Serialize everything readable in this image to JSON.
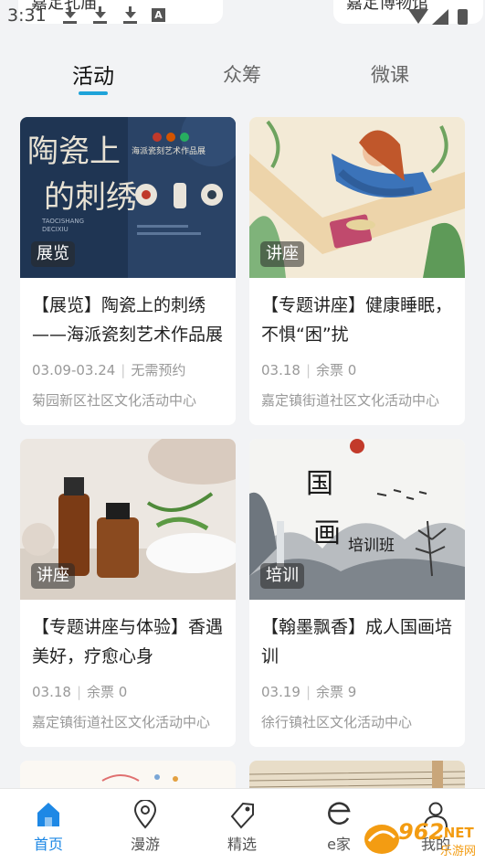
{
  "status_bar": {
    "time": "3:31",
    "chip_left": "嘉定孔庙",
    "chip_right": "嘉定博物馆"
  },
  "tabs": [
    {
      "label": "活动",
      "active": true
    },
    {
      "label": "众筹",
      "active": false
    },
    {
      "label": "微课",
      "active": false
    }
  ],
  "cards": [
    {
      "badge": "展览",
      "title": "【展览】陶瓷上的刺绣——海派瓷刻艺术作品展",
      "date": "03.09-03.24",
      "info": "无需预约",
      "venue": "菊园新区社区文化活动中心",
      "poster_text": {
        "title1": "陶瓷上",
        "title2": "的刺绣",
        "subtitle": "海派瓷刻艺术作品展",
        "pinyin": "TAOCISHANG DECIXIU"
      }
    },
    {
      "badge": "讲座",
      "title": "【专题讲座】健康睡眠，不惧“困”扰",
      "date": "03.18",
      "info": "余票 0",
      "venue": "嘉定镇街道社区文化活动中心"
    },
    {
      "badge": "讲座",
      "title": "【专题讲座与体验】香遇美好，疗愈心身",
      "date": "03.18",
      "info": "余票 0",
      "venue": "嘉定镇街道社区文化活动中心"
    },
    {
      "badge": "培训",
      "title": "【翰墨飘香】成人国画培训",
      "date": "03.19",
      "info": "余票 9",
      "venue": "徐行镇社区文化活动中心",
      "poster_text": {
        "t1": "国",
        "t2": "画",
        "t3": "培训班"
      }
    }
  ],
  "bottom_nav": [
    {
      "label": "首页",
      "icon": "home-icon",
      "active": true
    },
    {
      "label": "漫游",
      "icon": "location-pin-icon",
      "active": false
    },
    {
      "label": "精选",
      "icon": "tag-icon",
      "active": false
    },
    {
      "label": "e家",
      "icon": "e-home-icon",
      "active": false
    },
    {
      "label": "我的",
      "icon": "user-icon",
      "active": false
    }
  ],
  "watermark": {
    "brand": "962",
    "suffix": ".NET",
    "sub": "乐游网"
  },
  "colors": {
    "accent": "#1fa3d9",
    "nav_active": "#1e88e5",
    "background": "#f2f3f5"
  }
}
